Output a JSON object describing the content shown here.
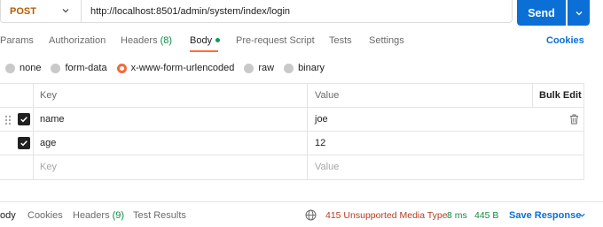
{
  "request": {
    "method": "POST",
    "url": "http://localhost:8501/admin/system/index/login",
    "send_label": "Send"
  },
  "tabs": [
    {
      "label": "Params"
    },
    {
      "label": "Authorization"
    },
    {
      "label": "Headers",
      "count": "(8)"
    },
    {
      "label": "Body",
      "active": true
    },
    {
      "label": "Pre-request Script"
    },
    {
      "label": "Tests"
    },
    {
      "label": "Settings"
    }
  ],
  "cookies_label": "Cookies",
  "body_types": [
    {
      "label": "none"
    },
    {
      "label": "form-data"
    },
    {
      "label": "x-www-form-urlencoded",
      "selected": true
    },
    {
      "label": "raw"
    },
    {
      "label": "binary"
    }
  ],
  "table": {
    "headers": {
      "key": "Key",
      "value": "Value",
      "bulk_edit": "Bulk Edit"
    },
    "rows": [
      {
        "key": "name",
        "value": "joe",
        "checked": true
      },
      {
        "key": "age",
        "value": "12",
        "checked": true
      }
    ],
    "placeholder": {
      "key": "Key",
      "value": "Value"
    }
  },
  "response": {
    "tabs": [
      {
        "label": "ody",
        "active": true
      },
      {
        "label": "Cookies"
      },
      {
        "label": "Headers",
        "count": "(9)"
      },
      {
        "label": "Test Results"
      }
    ],
    "status": "415 Unsupported Media Type",
    "time": "8 ms",
    "size": "445 B",
    "save_label": "Save Response"
  },
  "colors": {
    "accent": "#0c6fd6",
    "method": "#b25e00",
    "tab_indicator": "#ff6c37",
    "status_error": "#b43c21",
    "success": "#0f8a44"
  }
}
